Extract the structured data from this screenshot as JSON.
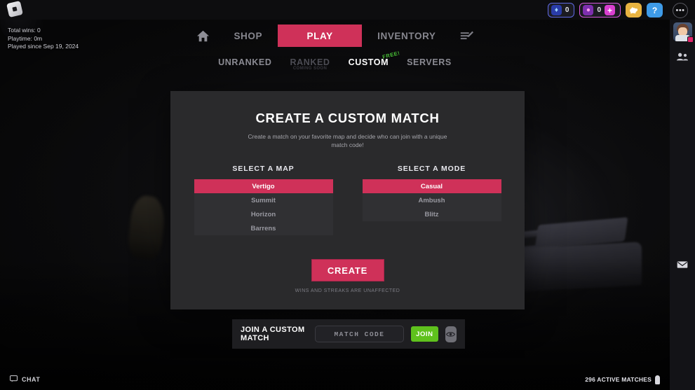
{
  "window": {
    "title": "Create a Custom Match"
  },
  "topbar": {
    "logo_icon": "roblox-logo-icon",
    "currencies": [
      {
        "id": "gem",
        "icon": "gem-icon",
        "value": "0"
      },
      {
        "id": "drop",
        "icon": "drop-icon",
        "value": "0",
        "plus_label": "+"
      }
    ],
    "buttons": [
      {
        "id": "piggy",
        "icon": "piggy-bank-icon",
        "glyph": "\u0001"
      },
      {
        "id": "help",
        "icon": "question-mark-icon",
        "label": "?"
      }
    ],
    "menu_icon": "three-dots-icon",
    "menu_label": "•••"
  },
  "stats": {
    "total_wins": "Total wins: 0",
    "playtime": "Playtime: 0m",
    "played_since": "Played since Sep 19, 2024"
  },
  "nav": {
    "home_icon": "home-icon",
    "items": [
      {
        "label": "SHOP",
        "active": false
      },
      {
        "label": "PLAY",
        "active": true
      },
      {
        "label": "INVENTORY",
        "active": false
      }
    ],
    "edit_icon": "edit-list-icon"
  },
  "subnav": {
    "items": [
      {
        "label": "UNRANKED",
        "state": "normal",
        "sub": ""
      },
      {
        "label": "RANKED",
        "state": "disabled",
        "sub": "COMING SOON"
      },
      {
        "label": "CUSTOM",
        "state": "active",
        "sub": "",
        "badge": "FREE!"
      },
      {
        "label": "SERVERS",
        "state": "normal",
        "sub": ""
      }
    ]
  },
  "modal": {
    "title": "CREATE A CUSTOM MATCH",
    "subtitle": "Create a match on your favorite map and decide who can join with a unique match code!",
    "map_section": {
      "header": "SELECT A MAP",
      "options": [
        {
          "label": "Vertigo",
          "selected": true
        },
        {
          "label": "Summit",
          "selected": false
        },
        {
          "label": "Horizon",
          "selected": false
        },
        {
          "label": "Barrens",
          "selected": false
        }
      ]
    },
    "mode_section": {
      "header": "SELECT A MODE",
      "options": [
        {
          "label": "Casual",
          "selected": true
        },
        {
          "label": "Ambush",
          "selected": false
        },
        {
          "label": "Blitz",
          "selected": false
        }
      ]
    },
    "create_button": "CREATE",
    "create_note": "WINS AND STREAKS ARE UNAFFECTED"
  },
  "join_bar": {
    "label": "JOIN A CUSTOM MATCH",
    "code_value": "",
    "code_placeholder": "MATCH CODE",
    "join_button": "JOIN",
    "eye_icon": "eye-icon"
  },
  "rail": {
    "avatar_icon": "user-avatar",
    "friends_icon": "friends-icon",
    "mail_icon": "envelope-icon"
  },
  "bottom": {
    "chat_icon": "chat-bubble-icon",
    "chat_label": "CHAT",
    "matches_label": "296 ACTIVE MATCHES",
    "matches_icon": "person-icon"
  },
  "colors": {
    "accent": "#cf3159",
    "green": "#5fc11d",
    "free_badge": "#4cc43a",
    "panel": "#2a2a2c",
    "list": "#303033"
  }
}
